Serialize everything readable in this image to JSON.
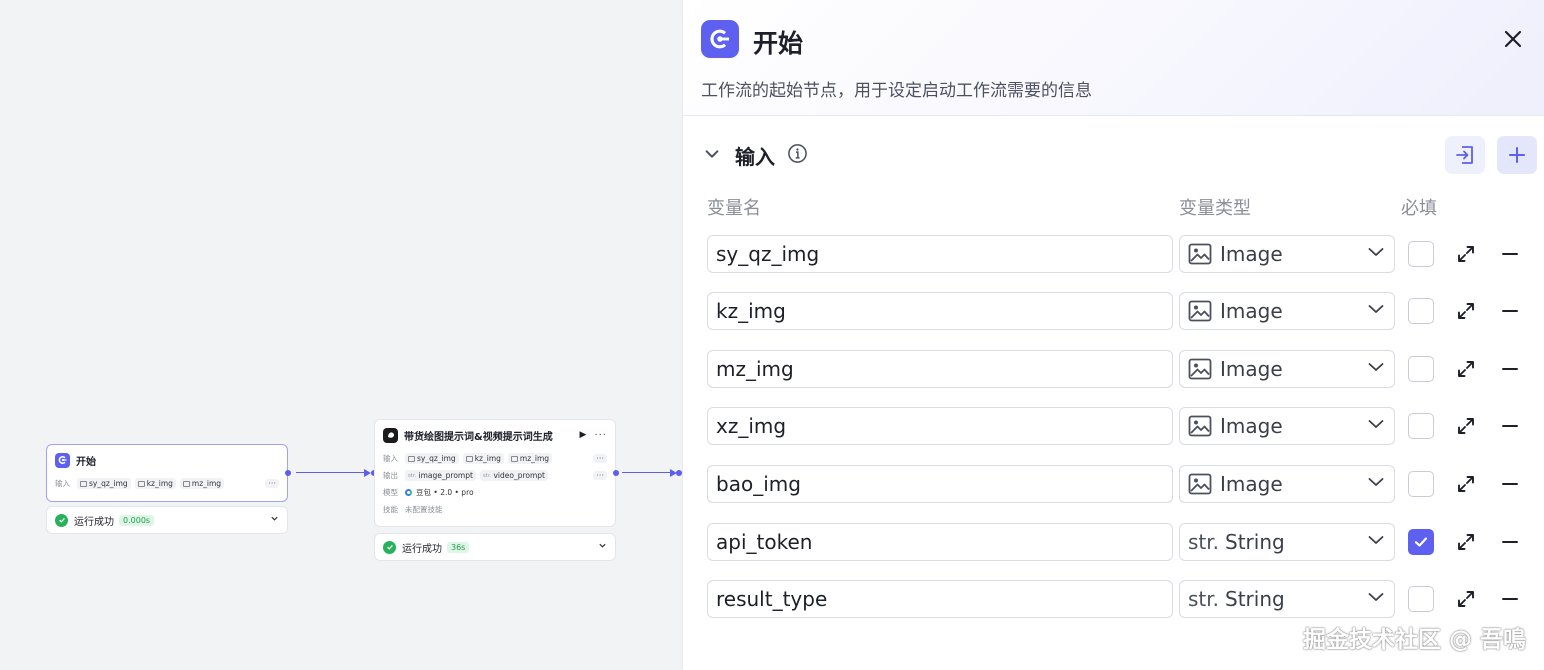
{
  "canvas": {
    "start_node": {
      "title": "开始",
      "input_label": "输入",
      "inputs": [
        "sy_qz_img",
        "kz_img",
        "mz_img"
      ],
      "more": "···",
      "status_text": "运行成功",
      "status_time": "0.000s"
    },
    "llm_node": {
      "title": "带货绘图提示词&视频提示词生成",
      "run_icon": "▶",
      "more": "···",
      "input_label": "输入",
      "inputs": [
        "sy_qz_img",
        "kz_img",
        "mz_img"
      ],
      "output_label": "输出",
      "outputs": [
        "image_prompt",
        "video_prompt"
      ],
      "str_prefix": "str.",
      "model_label": "模型",
      "model_value": "豆包 • 2.0 • pro",
      "skill_label": "技能",
      "skill_value": "未配置技能",
      "status_text": "运行成功",
      "status_time": "36s"
    }
  },
  "panel": {
    "title": "开始",
    "description": "工作流的起始节点，用于设定启动工作流需要的信息",
    "section_title": "输入",
    "columns": {
      "name": "变量名",
      "type": "变量类型",
      "required": "必填"
    },
    "variables": [
      {
        "name": "sy_qz_img",
        "type": "Image",
        "type_icon": "image-icon",
        "required": false
      },
      {
        "name": "kz_img",
        "type": "Image",
        "type_icon": "image-icon",
        "required": false
      },
      {
        "name": "mz_img",
        "type": "Image",
        "type_icon": "image-icon",
        "required": false
      },
      {
        "name": "xz_img",
        "type": "Image",
        "type_icon": "image-icon",
        "required": false
      },
      {
        "name": "bao_img",
        "type": "Image",
        "type_icon": "image-icon",
        "required": false
      },
      {
        "name": "api_token",
        "type": "String",
        "type_icon": "str.",
        "required": true
      },
      {
        "name": "result_type",
        "type": "String",
        "type_icon": "str.",
        "required": false
      }
    ]
  },
  "watermark": "掘金技术社区 @ 吾鳴",
  "colors": {
    "accent": "#5e60f0",
    "success": "#27b15a",
    "edge": "#5b5ff0"
  }
}
